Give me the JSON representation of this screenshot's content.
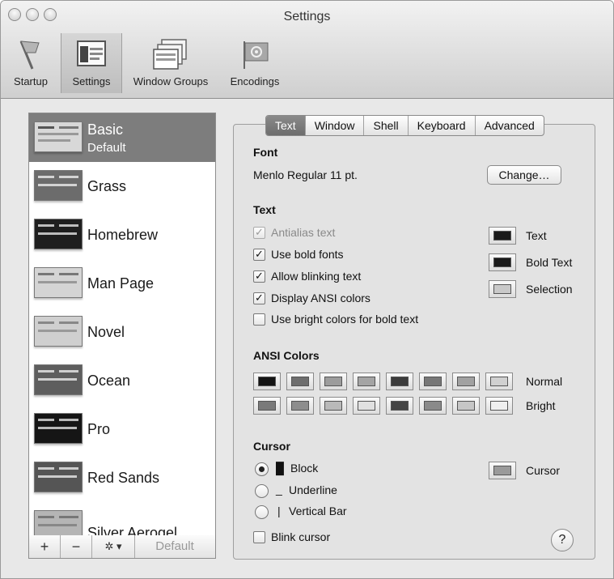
{
  "window": {
    "title": "Settings"
  },
  "toolbar": {
    "items": [
      {
        "label": "Startup",
        "icon": "flag-icon"
      },
      {
        "label": "Settings",
        "icon": "settings-window-icon"
      },
      {
        "label": "Window Groups",
        "icon": "window-groups-icon"
      },
      {
        "label": "Encodings",
        "icon": "un-flag-icon"
      }
    ],
    "selected": "Settings"
  },
  "profiles": {
    "items": [
      {
        "name": "Basic",
        "sub": "Default",
        "thumb_color": "#d8d8d8"
      },
      {
        "name": "Grass",
        "sub": "",
        "thumb_color": "#6c6c6c"
      },
      {
        "name": "Homebrew",
        "sub": "",
        "thumb_color": "#1e1e1e"
      },
      {
        "name": "Man Page",
        "sub": "",
        "thumb_color": "#d4d4d4"
      },
      {
        "name": "Novel",
        "sub": "",
        "thumb_color": "#cfcfcf"
      },
      {
        "name": "Ocean",
        "sub": "",
        "thumb_color": "#5e5e5e"
      },
      {
        "name": "Pro",
        "sub": "",
        "thumb_color": "#151515"
      },
      {
        "name": "Red Sands",
        "sub": "",
        "thumb_color": "#555555"
      },
      {
        "name": "Silver Aerogel",
        "sub": "",
        "thumb_color": "#b5b5b5"
      }
    ],
    "selected": "Basic",
    "buttons": {
      "add": "+",
      "remove": "−",
      "action": "✲ ▾",
      "default": "Default"
    }
  },
  "tabs": [
    "Text",
    "Window",
    "Shell",
    "Keyboard",
    "Advanced"
  ],
  "selected_tab": "Text",
  "font": {
    "heading": "Font",
    "value": "Menlo Regular 11 pt.",
    "change": "Change…"
  },
  "text": {
    "heading": "Text",
    "options": [
      {
        "label": "Antialias text",
        "checked": true,
        "enabled": false
      },
      {
        "label": "Use bold fonts",
        "checked": true,
        "enabled": true
      },
      {
        "label": "Allow blinking text",
        "checked": true,
        "enabled": true
      },
      {
        "label": "Display ANSI colors",
        "checked": true,
        "enabled": true
      },
      {
        "label": "Use bright colors for bold text",
        "checked": false,
        "enabled": true
      }
    ],
    "colors": [
      {
        "label": "Text",
        "swatch": "#1a1a1a"
      },
      {
        "label": "Bold Text",
        "swatch": "#1a1a1a"
      },
      {
        "label": "Selection",
        "swatch": "#c9c9c9"
      }
    ]
  },
  "ansi": {
    "heading": "ANSI Colors",
    "rows": [
      {
        "label": "Normal",
        "swatches": [
          "#141414",
          "#6e6e6e",
          "#9c9c9c",
          "#a4a4a4",
          "#3c3c3c",
          "#777777",
          "#a1a1a1",
          "#d0d0d0"
        ]
      },
      {
        "label": "Bright",
        "swatches": [
          "#7a7a7a",
          "#8d8d8d",
          "#b9b9b9",
          "#e0e0e0",
          "#444444",
          "#8a8a8a",
          "#c6c6c6",
          "#efefef"
        ]
      }
    ]
  },
  "cursor": {
    "heading": "Cursor",
    "options": [
      {
        "glyph": "█",
        "label": "Block",
        "selected": true
      },
      {
        "glyph": "_",
        "label": "Underline",
        "selected": false
      },
      {
        "glyph": "|",
        "label": "Vertical Bar",
        "selected": false
      }
    ],
    "blink_label": "Blink cursor",
    "blink_checked": false,
    "color_label": "Cursor",
    "color_swatch": "#9a9a9a"
  },
  "help": {
    "label": "?"
  }
}
